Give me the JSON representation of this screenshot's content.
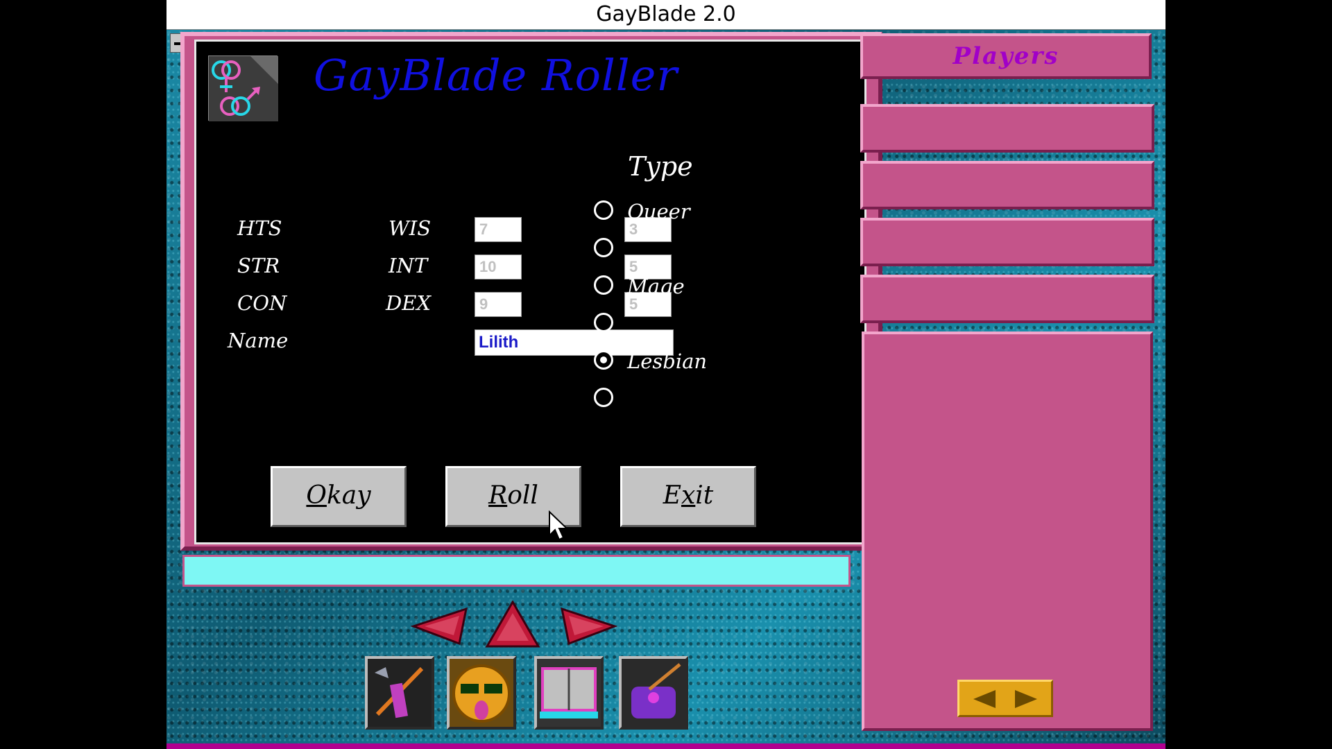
{
  "window": {
    "title": "GayBlade 2.0"
  },
  "roller": {
    "title": "GayBlade Roller",
    "stats": {
      "hts_label": "HTS",
      "hts_value": "7",
      "str_label": "STR",
      "str_value": "10",
      "con_label": "CON",
      "con_value": "9",
      "wis_label": "WIS",
      "wis_value": "3",
      "int_label": "INT",
      "int_value": "5",
      "dex_label": "DEX",
      "dex_value": "5"
    },
    "name_label": "Name",
    "name_value": "Lilith",
    "type_heading": "Type",
    "types": [
      {
        "label": "Queer",
        "selected": false
      },
      {
        "label": "",
        "selected": false
      },
      {
        "label": "Mage",
        "selected": false
      },
      {
        "label": "",
        "selected": false
      },
      {
        "label": "Lesbian",
        "selected": true
      },
      {
        "label": "",
        "selected": false
      }
    ],
    "buttons": {
      "okay": {
        "underlined": "O",
        "rest": "kay"
      },
      "roll": {
        "underlined": "R",
        "rest": "oll"
      },
      "exit": {
        "before": "E",
        "underlined": "x",
        "rest": "it"
      }
    }
  },
  "players": {
    "header": "Players"
  },
  "icons": {
    "logo": "gender-symbols-logo",
    "nav": [
      "left-arrow-icon",
      "up-arrow-icon",
      "right-arrow-icon"
    ],
    "toolbar": [
      "weapons-icon",
      "character-face-icon",
      "spellbook-icon",
      "inventory-bag-icon"
    ],
    "pager": [
      "pager-left-icon",
      "pager-right-icon"
    ]
  },
  "colors": {
    "accent_pink": "#c4548a",
    "title_blue": "#1010e0",
    "players_purple": "#a100c8",
    "status_cyan": "#7ef7f4",
    "name_text_blue": "#1a1ac8"
  }
}
